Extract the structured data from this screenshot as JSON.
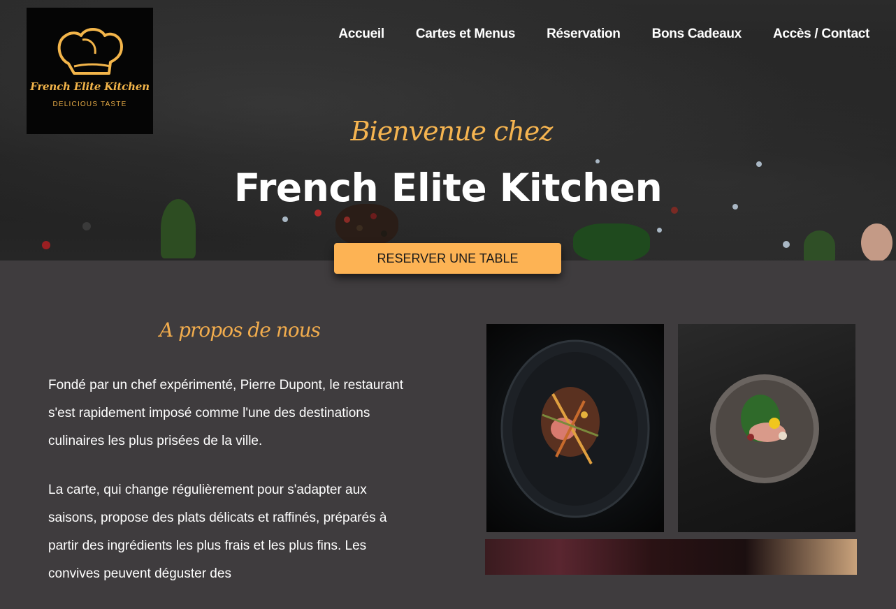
{
  "brand": {
    "logo_name": "French Elite Kitchen",
    "logo_tagline": "DELICIOUS TASTE",
    "logo_icon": "chef-hat-icon",
    "accent_color": "#fdb354"
  },
  "nav": {
    "items": [
      {
        "label": "Accueil"
      },
      {
        "label": "Cartes et Menus"
      },
      {
        "label": "Réservation"
      },
      {
        "label": "Bons Cadeaux"
      },
      {
        "label": "Accès / Contact"
      }
    ]
  },
  "hero": {
    "welcome": "Bienvenue chez",
    "title": "French Elite Kitchen",
    "cta_label": "RESERVER UNE TABLE"
  },
  "about": {
    "title": "A propos de nous",
    "paragraphs": [
      "Fondé par un chef expérimenté, Pierre Dupont, le restaurant s'est rapidement imposé comme l'une des destinations culinaires les plus prisées de la ville.",
      "La carte, qui change régulièrement pour s'adapter aux saisons, propose des plats délicats et raffinés, préparés à partir des ingrédients les plus frais et les plus fins. Les convives peuvent déguster des"
    ]
  }
}
